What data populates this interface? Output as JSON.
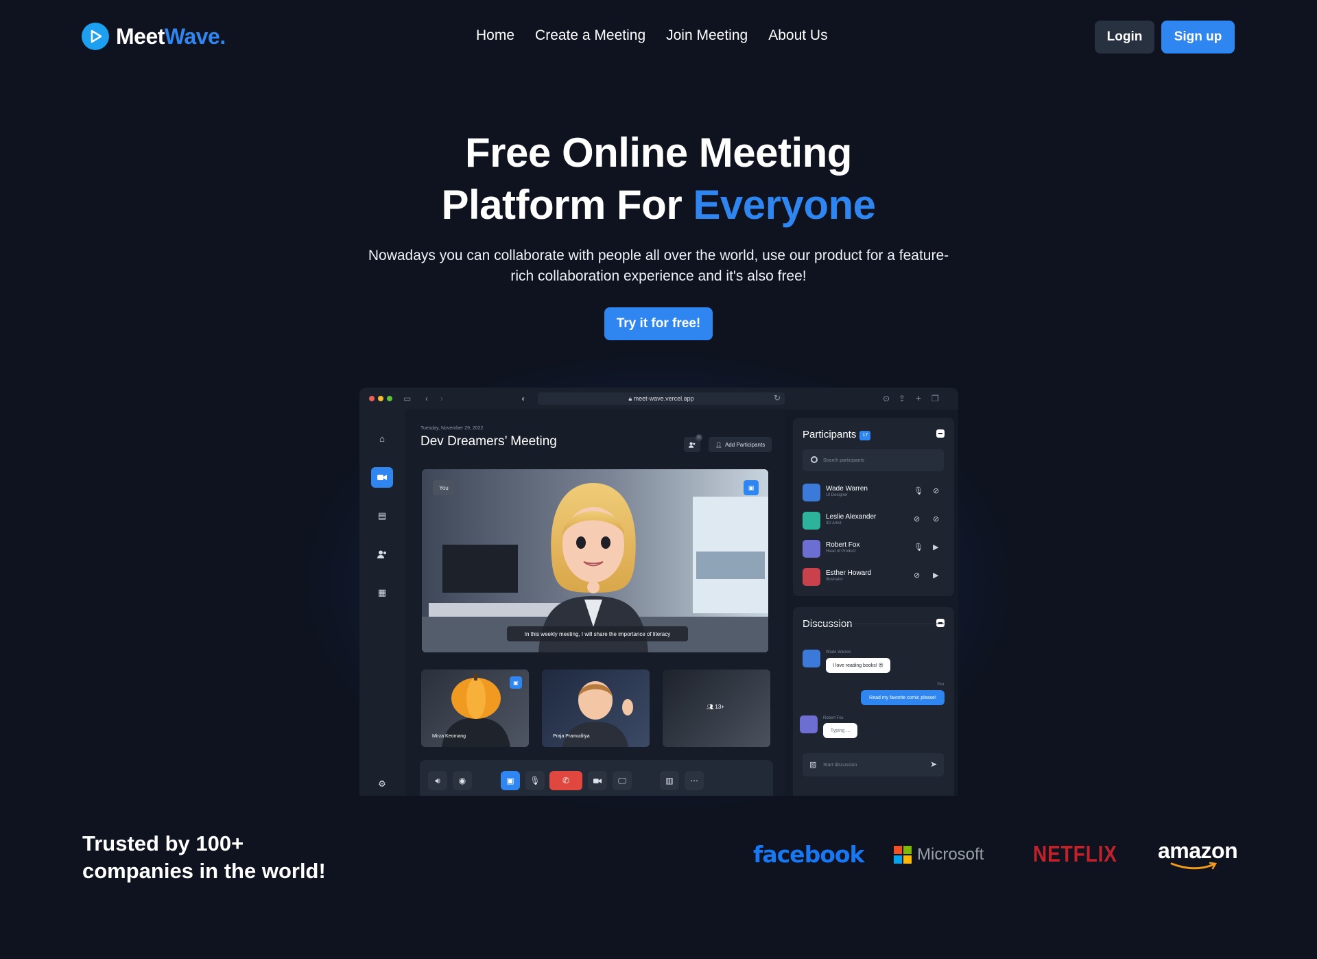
{
  "brand": {
    "name_part1": "Meet",
    "name_part2": "Wave."
  },
  "nav": {
    "links": [
      "Home",
      "Create a Meeting",
      "Join Meeting",
      "About Us"
    ],
    "login": "Login",
    "signup": "Sign up"
  },
  "hero": {
    "title_line1": "Free Online Meeting",
    "title_line2_plain": "Platform For ",
    "title_line2_accent": "Everyone",
    "subtitle": "Nowadays you can collaborate with people all over the world, use our product for a feature-rich collaboration experience and it's also free!",
    "cta": "Try it for free!"
  },
  "browser": {
    "url": "meet-wave.vercel.app"
  },
  "app": {
    "date": "Tuesday, November 29, 2022",
    "meeting_title": "Dev Dreamers’ Meeting",
    "participants_badge": "11",
    "add_participants": "Add Participants",
    "you_tag": "You",
    "caption": "In this weekly meeting, I will share the importance of literacy",
    "thumbs": [
      "Mirza Keomang",
      "Praja Pramuditya"
    ],
    "more_count": "13+",
    "participants_panel": {
      "title": "Participants",
      "count": "17",
      "search_placeholder": "Search participants",
      "people": [
        {
          "name": "Wade Warren",
          "role": "UI Designer",
          "mic": "on",
          "cam": "off"
        },
        {
          "name": "Leslie Alexander",
          "role": "3D Artist",
          "mic": "off",
          "cam": "off"
        },
        {
          "name": "Robert Fox",
          "role": "Head of Product",
          "mic": "on",
          "cam": "on"
        },
        {
          "name": "Esther Howard",
          "role": "Illustrator",
          "mic": "off",
          "cam": "on"
        }
      ]
    },
    "discussion": {
      "title": "Discussion",
      "msg1_author": "Wade Warren",
      "msg1_text": "I love reading books! 😍",
      "msg2_author": "You",
      "msg2_text": "Read my favorite comic please!",
      "msg3_author": "Robert Fox",
      "msg3_text": "Typing ...",
      "input_placeholder": "Start discussion"
    }
  },
  "trusted": {
    "line1": "Trusted by 100+",
    "line2": "companies in the world!"
  },
  "logos": {
    "facebook": "facebook",
    "microsoft": "Microsoft",
    "netflix": "NETFLIX",
    "amazon": "amazon"
  },
  "colors": {
    "background": "#0e131f",
    "accent": "#2f86f0",
    "end_call": "#e0473f",
    "netflix": "#c0222b",
    "amazon_arrow": "#f29a1b"
  }
}
